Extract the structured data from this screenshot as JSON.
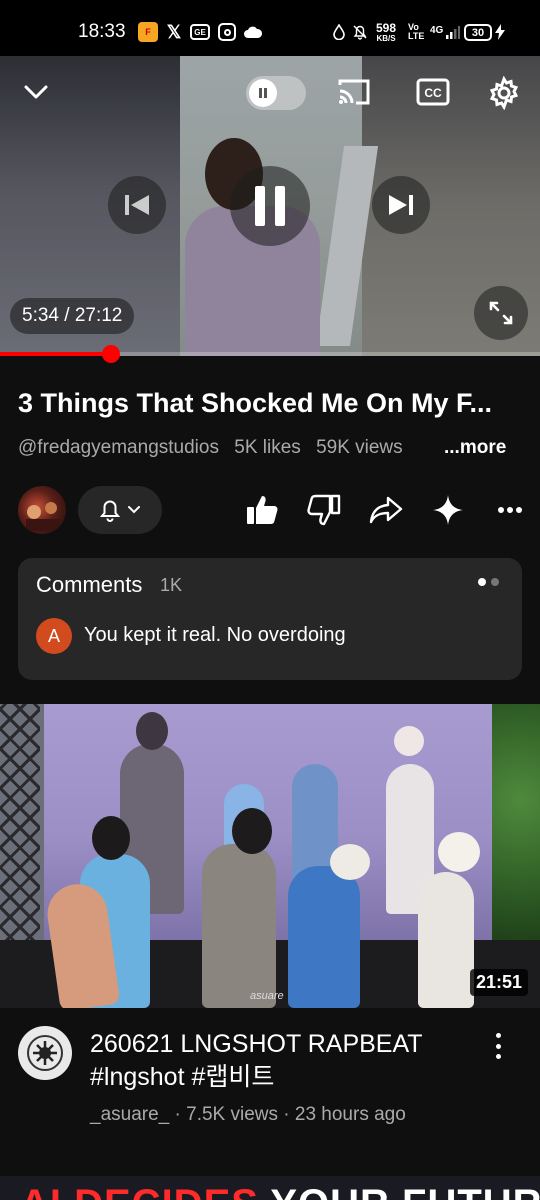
{
  "status_bar": {
    "time": "18:33",
    "speed_value": "598",
    "speed_unit": "KB/S",
    "network": "4G",
    "battery": "30"
  },
  "player": {
    "current_time": "5:34",
    "duration": "27:12",
    "progress_fraction": 0.205,
    "icons": [
      "chevron-down-icon",
      "autoplay-toggle",
      "cast-icon",
      "captions-icon",
      "settings-icon",
      "previous-icon",
      "pause-icon",
      "next-icon",
      "fullscreen-icon"
    ]
  },
  "video": {
    "title": "3 Things That Shocked Me On My F...",
    "channel": "@fredagyemangstudios",
    "likes": "5K likes",
    "views": "59K views",
    "more": "...more"
  },
  "actions": [
    "like-icon",
    "dislike-icon",
    "share-icon",
    "ask-sparkle-icon",
    "more-icon"
  ],
  "comments": {
    "title": "Comments",
    "count": "1K",
    "top_comment_avatar": "A",
    "top_comment_text": "You kept it real. No overdoing"
  },
  "next_video": {
    "duration": "21:51",
    "watermark": "asuare",
    "title": "260621 LNGSHOT RAPBEAT #lngshot #랩비트",
    "channel": "_asuare_",
    "views": "7.5K views",
    "age": "23 hours ago"
  },
  "bottom_strip": {
    "text_red": "AI DECIDES",
    "text_white": "YOUR FUTURE"
  },
  "colors": {
    "background": "#0f0f0f",
    "card": "#272727",
    "accent_red": "#ff0000",
    "secondary_text": "#aaaaaa",
    "comment_avatar": "#d24b1f"
  }
}
